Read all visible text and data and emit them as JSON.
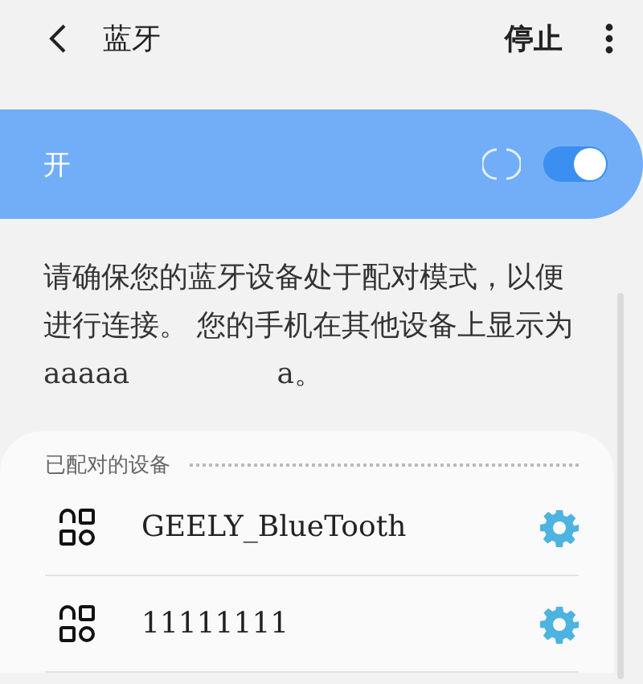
{
  "header": {
    "title": "蓝牙",
    "action": "停止"
  },
  "master_switch": {
    "label": "开",
    "on": true,
    "loading": true
  },
  "description": "请确保您的蓝牙设备处于配对模式，以便进行连接。 您的手机在其他设备上显示为aaaaa                a。",
  "paired": {
    "heading": "已配对的设备",
    "devices": [
      {
        "name": "GEELY_BlueTooth"
      },
      {
        "name": "11111111"
      }
    ]
  }
}
